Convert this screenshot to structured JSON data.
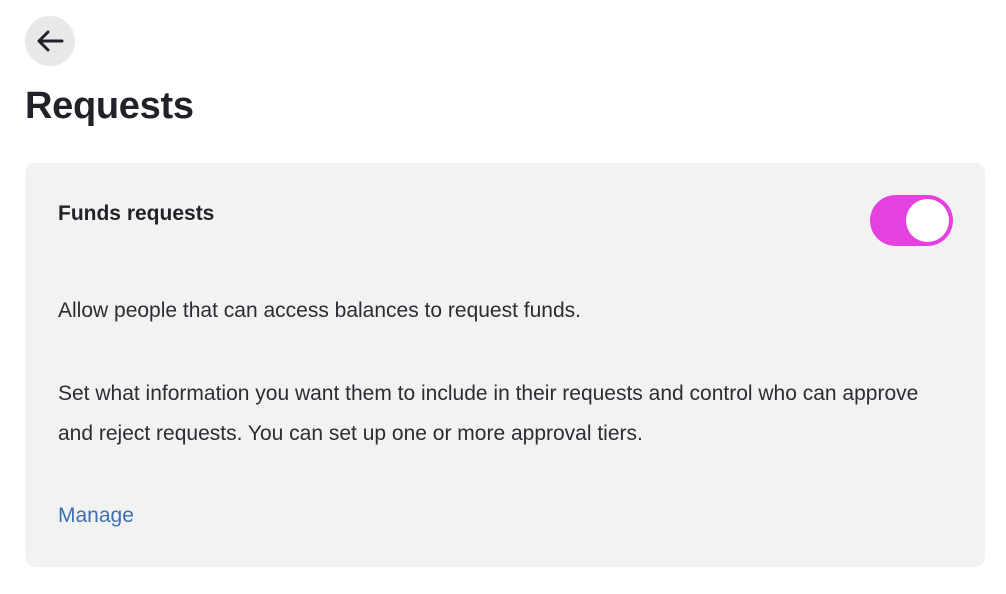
{
  "header": {
    "back_icon": "arrow-left-icon",
    "title": "Requests"
  },
  "funds_requests_card": {
    "title": "Funds requests",
    "toggle_enabled": true,
    "toggle_color": "#e441e0",
    "description_1": "Allow people that can access balances to request funds.",
    "description_2": "Set what information you want them to include in their requests and control who can approve and reject requests. You can set up one or more approval tiers.",
    "manage_label": "Manage",
    "link_color": "#3f6fb0"
  }
}
